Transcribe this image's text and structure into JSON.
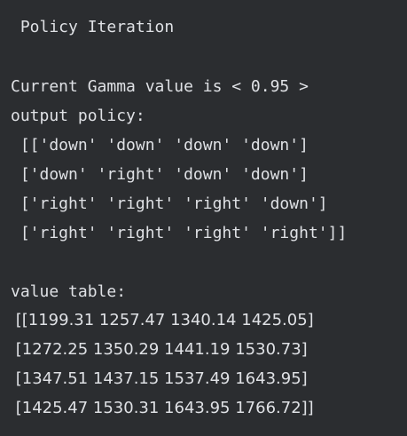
{
  "console": {
    "heading": " Policy Iteration",
    "gamma_line": "Current Gamma value is < 0.95 >",
    "policy_label": "output policy:",
    "policy_rows": [
      " [['down' 'down' 'down' 'down']",
      " ['down' 'right' 'down' 'down']",
      " ['right' 'right' 'right' 'down']",
      " ['right' 'right' 'right' 'right']]"
    ],
    "value_label": "value table:",
    "value_rows": [
      " [[1199.31 1257.47 1340.14 1425.05]",
      " [1272.25 1350.29 1441.19 1530.73]",
      " [1347.51 1437.15 1537.49 1643.95]",
      " [1425.47 1530.31 1643.95 1766.72]]"
    ]
  }
}
